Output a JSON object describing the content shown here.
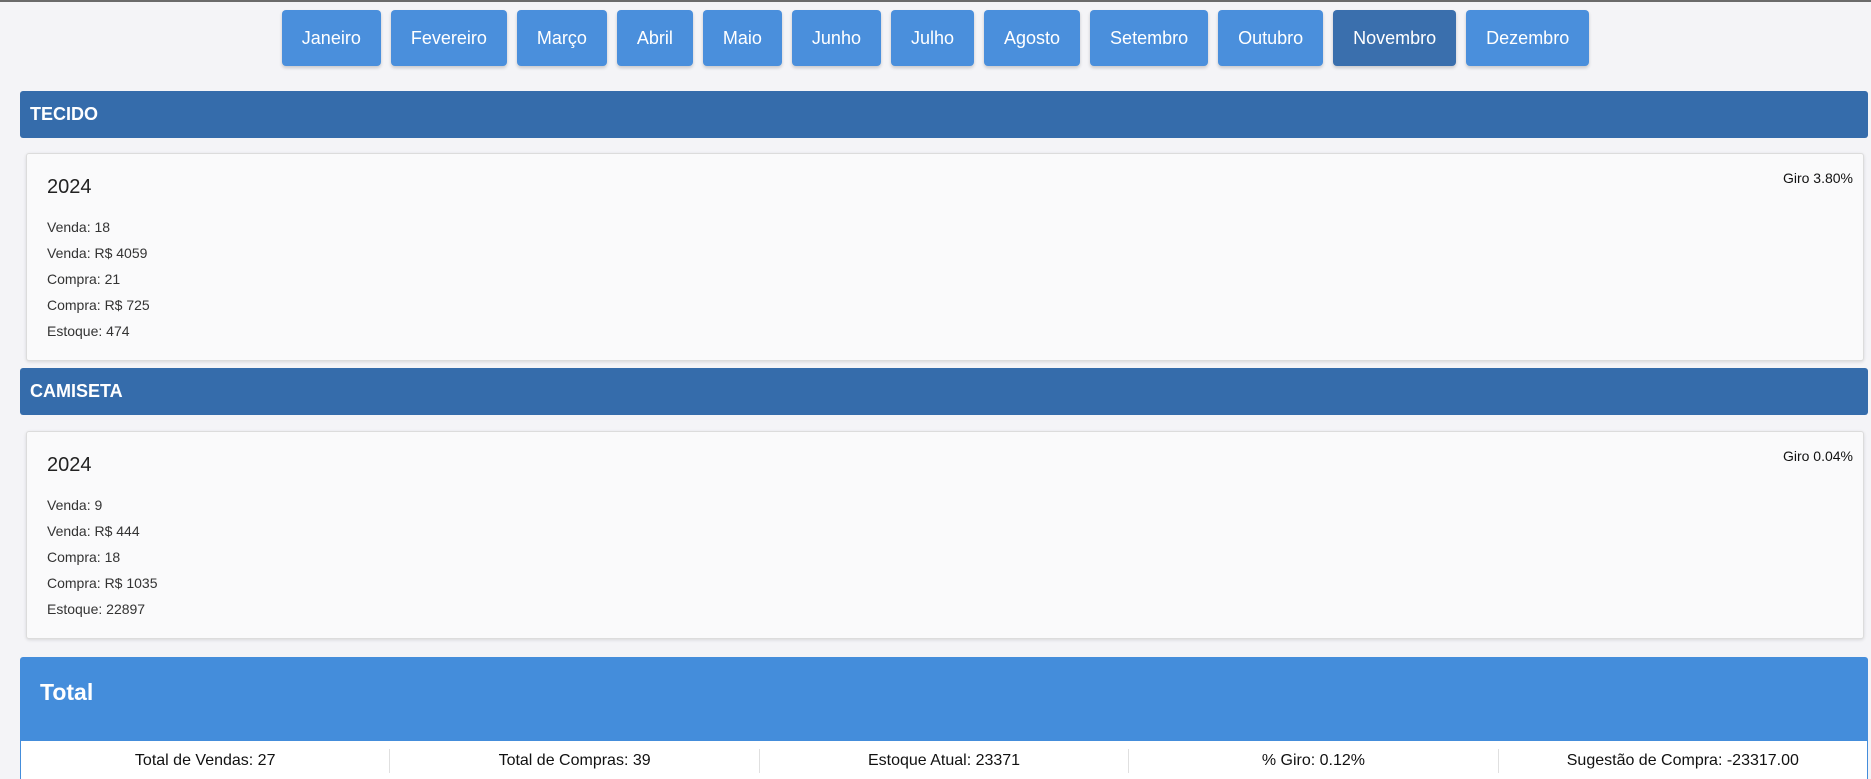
{
  "months": [
    {
      "label": "Janeiro",
      "active": false
    },
    {
      "label": "Fevereiro",
      "active": false
    },
    {
      "label": "Março",
      "active": false
    },
    {
      "label": "Abril",
      "active": false
    },
    {
      "label": "Maio",
      "active": false
    },
    {
      "label": "Junho",
      "active": false
    },
    {
      "label": "Julho",
      "active": false
    },
    {
      "label": "Agosto",
      "active": false
    },
    {
      "label": "Setembro",
      "active": false
    },
    {
      "label": "Outubro",
      "active": false
    },
    {
      "label": "Novembro",
      "active": true
    },
    {
      "label": "Dezembro",
      "active": false
    }
  ],
  "categories": [
    {
      "name": "TECIDO",
      "year": "2024",
      "giro": "Giro 3.80%",
      "stats": [
        "Venda: 18",
        "Venda: R$ 4059",
        "Compra: 21",
        "Compra: R$ 725",
        "Estoque: 474"
      ]
    },
    {
      "name": "CAMISETA",
      "year": "2024",
      "giro": "Giro 0.04%",
      "stats": [
        "Venda: 9",
        "Venda: R$ 444",
        "Compra: 18",
        "Compra: R$ 1035",
        "Estoque: 22897"
      ]
    }
  ],
  "total": {
    "title": "Total",
    "cells": [
      "Total de Vendas: 27",
      "Total de Compras: 39",
      "Estoque Atual: 23371",
      "% Giro: 0.12%",
      "Sugestão de Compra: -23317.00"
    ]
  },
  "colors": {
    "month_button": "#4a8fdc",
    "month_button_active": "#3a6fad",
    "category_header": "#356cab",
    "total_header": "#448ddb"
  }
}
